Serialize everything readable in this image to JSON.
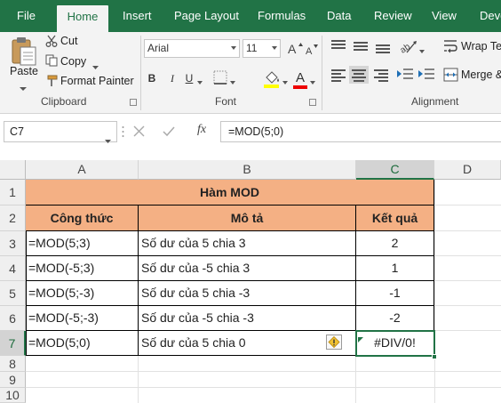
{
  "ribbon_tabs": [
    "File",
    "Home",
    "Insert",
    "Page Layout",
    "Formulas",
    "Data",
    "Review",
    "View",
    "Deve"
  ],
  "active_tab": "Home",
  "clipboard": {
    "paste_label": "Paste",
    "cut_label": "Cut",
    "copy_label": "Copy",
    "format_painter_label": "Format Painter",
    "group_label": "Clipboard"
  },
  "font": {
    "name": "Arial",
    "size": "11",
    "bold": "B",
    "italic": "I",
    "underline": "U",
    "font_color_letter": "A",
    "group_label": "Font"
  },
  "alignment": {
    "wrap_text_label": "Wrap Tex",
    "merge_label": "Merge &",
    "group_label": "Alignment"
  },
  "formula_bar": {
    "name_box": "C7",
    "fx_label": "fx",
    "formula": "=MOD(5;0)"
  },
  "columns": [
    "A",
    "B",
    "C",
    "D"
  ],
  "selected_column": "C",
  "rows": [
    "1",
    "2",
    "3",
    "4",
    "5",
    "6",
    "7",
    "8",
    "9",
    "10"
  ],
  "selected_row": "7",
  "sheet": {
    "title": "Hàm MOD",
    "headers": [
      "Công thức",
      "Mô tả",
      "Kết quả"
    ],
    "data_rows": [
      {
        "formula": "=MOD(5;3)",
        "description": "Số dư của 5 chia 3",
        "result": "2"
      },
      {
        "formula": "=MOD(-5;3)",
        "description": "Số dư của -5 chia 3",
        "result": "1"
      },
      {
        "formula": "=MOD(5;-3)",
        "description": "Số dư của 5 chia -3",
        "result": "-1"
      },
      {
        "formula": "=MOD(-5;-3)",
        "description": "Số dư của -5 chia -3",
        "result": "-2"
      },
      {
        "formula": "=MOD(5;0)",
        "description": "Số dư của 5 chia 0",
        "result": "#DIV/0!"
      }
    ]
  },
  "colors": {
    "accent": "#217346",
    "header_fill": "#f4b084",
    "error_triangle": "#217346"
  }
}
